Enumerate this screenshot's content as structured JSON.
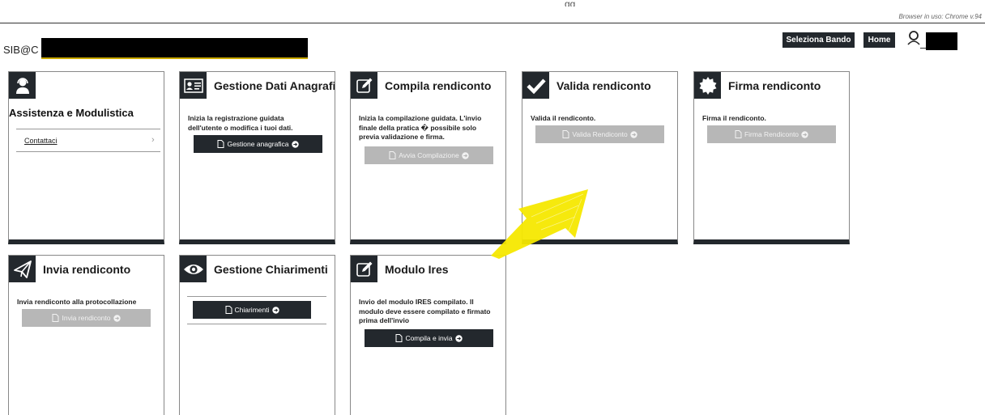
{
  "header": {
    "top_mark": "gg",
    "browser_info": "Browser in uso: Chrome v.94",
    "brand": "SIB@C",
    "buttons": {
      "seleziona_bando": "Seleziona Bando",
      "home": "Home"
    }
  },
  "cards": {
    "assistenza": {
      "title": "Assistenza e Modulistica",
      "link": "Contattaci"
    },
    "anagrafica": {
      "title": "Gestione Dati Anagrafici",
      "desc_lines": [
        "Inizia la registrazione guidata",
        "dell'utente o modifica i tuoi dati."
      ],
      "button": "Gestione anagrafica"
    },
    "compila": {
      "title": "Compila rendiconto",
      "desc_lines": [
        "Inizia la compilazione guidata. L'invio",
        "finale della pratica � possibile solo",
        "previa validazione e firma."
      ],
      "button": "Avvia Compilazione"
    },
    "valida": {
      "title": "Valida rendiconto",
      "desc_lines": [
        "Valida il rendiconto."
      ],
      "button": "Valida Rendiconto"
    },
    "firma": {
      "title": "Firma rendiconto",
      "desc_lines": [
        "Firma il rendiconto."
      ],
      "button": "Firma Rendiconto"
    },
    "invia": {
      "title": "Invia rendiconto",
      "desc_lines": [
        "Invia rendiconto alla protocollazione"
      ],
      "button": "Invia rendiconto"
    },
    "chiarimenti": {
      "title": "Gestione Chiarimenti",
      "button": "Chiarimenti"
    },
    "ires": {
      "title": "Modulo Ires",
      "desc_lines": [
        "Invio del modulo IRES compilato. Il",
        "modulo deve essere compilato e firmato",
        "prima dell'invio"
      ],
      "button": "Compila e invia"
    }
  },
  "colors": {
    "dark": "#23282d",
    "disabled_button": "#b7b7b7",
    "highlight_arrow": "#f5e800",
    "brand_underline": "#c9a800"
  },
  "icons": {
    "assistenza": "support-agent-icon",
    "anagrafica": "id-card-icon",
    "compila": "edit-icon",
    "valida": "checkmark-icon",
    "firma": "seal-icon",
    "invia": "paper-plane-icon",
    "chiarimenti": "eye-icon",
    "ires": "edit-icon",
    "button": "file-icon",
    "arrow": "arrow-circle-right-icon",
    "user": "user-icon"
  }
}
